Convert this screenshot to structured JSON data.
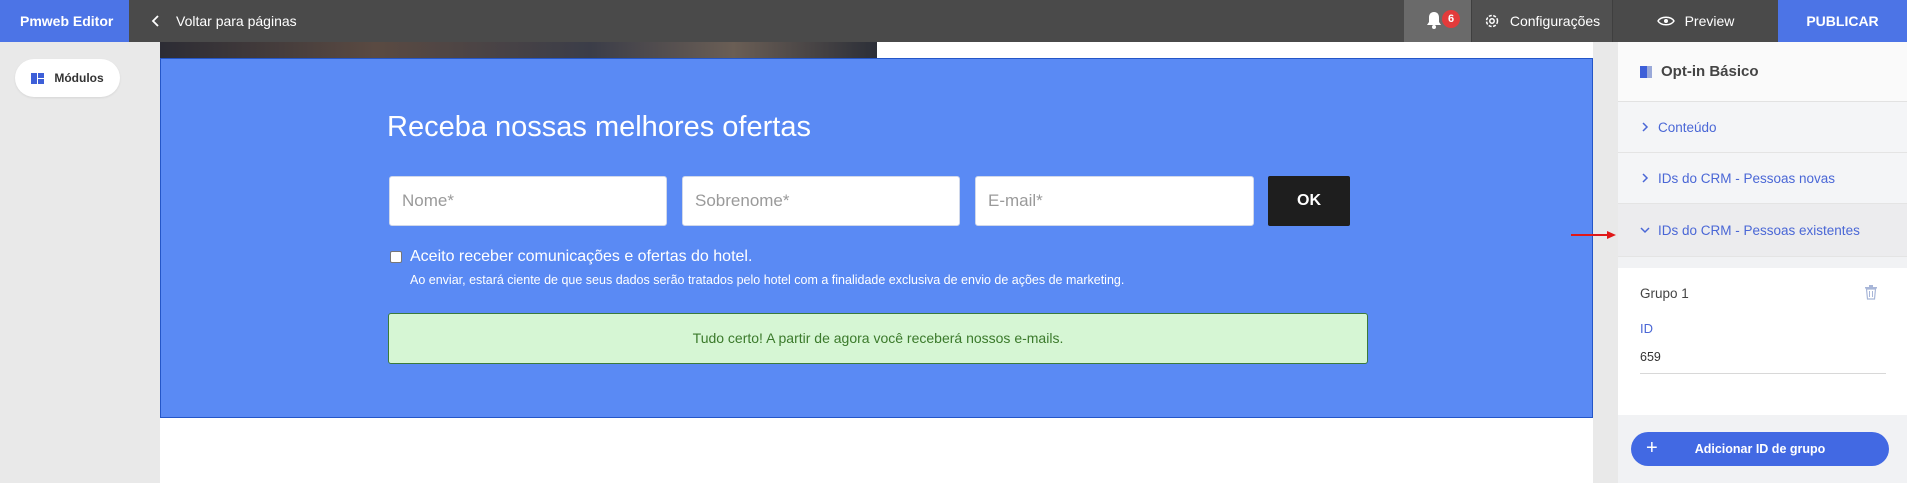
{
  "topbar": {
    "brand": "Pmweb Editor",
    "back_label": "Voltar para páginas",
    "notification_count": "6",
    "settings_label": "Configurações",
    "preview_label": "Preview",
    "publish_label": "PUBLICAR"
  },
  "sidebar": {
    "modules_label": "Módulos"
  },
  "optin": {
    "title": "Receba nossas melhores ofertas",
    "name_placeholder": "Nome*",
    "surname_placeholder": "Sobrenome*",
    "email_placeholder": "E-mail*",
    "submit_label": "OK",
    "consent_label": "Aceito receber comunicações e ofertas do hotel.",
    "disclaimer": "Ao enviar, estará ciente de que seus dados serão tratados pelo hotel com a finalidade exclusiva de envio de ações de marketing.",
    "success_message": "Tudo certo! A partir de agora você receberá nossos e-mails."
  },
  "panel": {
    "title": "Opt-in Básico",
    "sections": [
      {
        "label": "Conteúdo",
        "expanded": false
      },
      {
        "label": "IDs do CRM - Pessoas novas",
        "expanded": false
      },
      {
        "label": "IDs do CRM - Pessoas existentes",
        "expanded": true
      }
    ],
    "group": {
      "title": "Grupo 1",
      "id_label": "ID",
      "id_value": "659"
    },
    "add_group_label": "Adicionar ID de grupo"
  },
  "colors": {
    "brand_blue": "#4c74e6",
    "optin_bg": "#5a8af4",
    "success_bg": "#d6f6d4",
    "link_blue": "#4a67d6",
    "badge_red": "#e23b3b"
  }
}
